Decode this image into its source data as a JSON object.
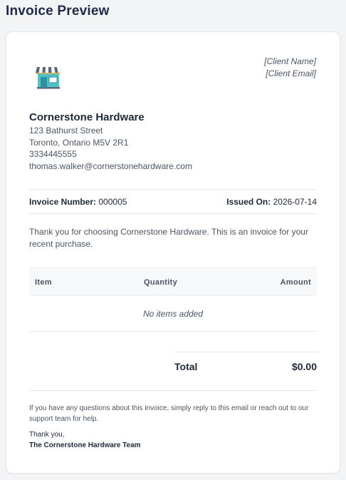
{
  "page": {
    "title": "Invoice Preview"
  },
  "client": {
    "name": "[Client Name]",
    "email": "[Client Email]"
  },
  "company": {
    "name": "Cornerstone Hardware",
    "street": "123 Bathurst Street",
    "city": "Toronto, Ontario M5V 2R1",
    "phone": "3334445555",
    "email": "thomas.walker@cornerstonehardware.com",
    "logo_icon": "storefront-icon"
  },
  "invoice": {
    "number_label": "Invoice Number:",
    "number": "000005",
    "issued_label": "Issued On:",
    "issued": "2026-07-14"
  },
  "message": "Thank you for choosing Cornerstone Hardware. This is an invoice for your recent purchase.",
  "table": {
    "headers": {
      "item": "Item",
      "quantity": "Quantity",
      "amount": "Amount"
    },
    "empty": "No items added"
  },
  "total": {
    "label": "Total",
    "value": "$0.00"
  },
  "footer": {
    "note": "If you have any questions about this invoice, simply reply to this email or reach out to our support team for help.",
    "thanks": "Thank you,",
    "team": "The Cornerstone Hardware Team"
  }
}
